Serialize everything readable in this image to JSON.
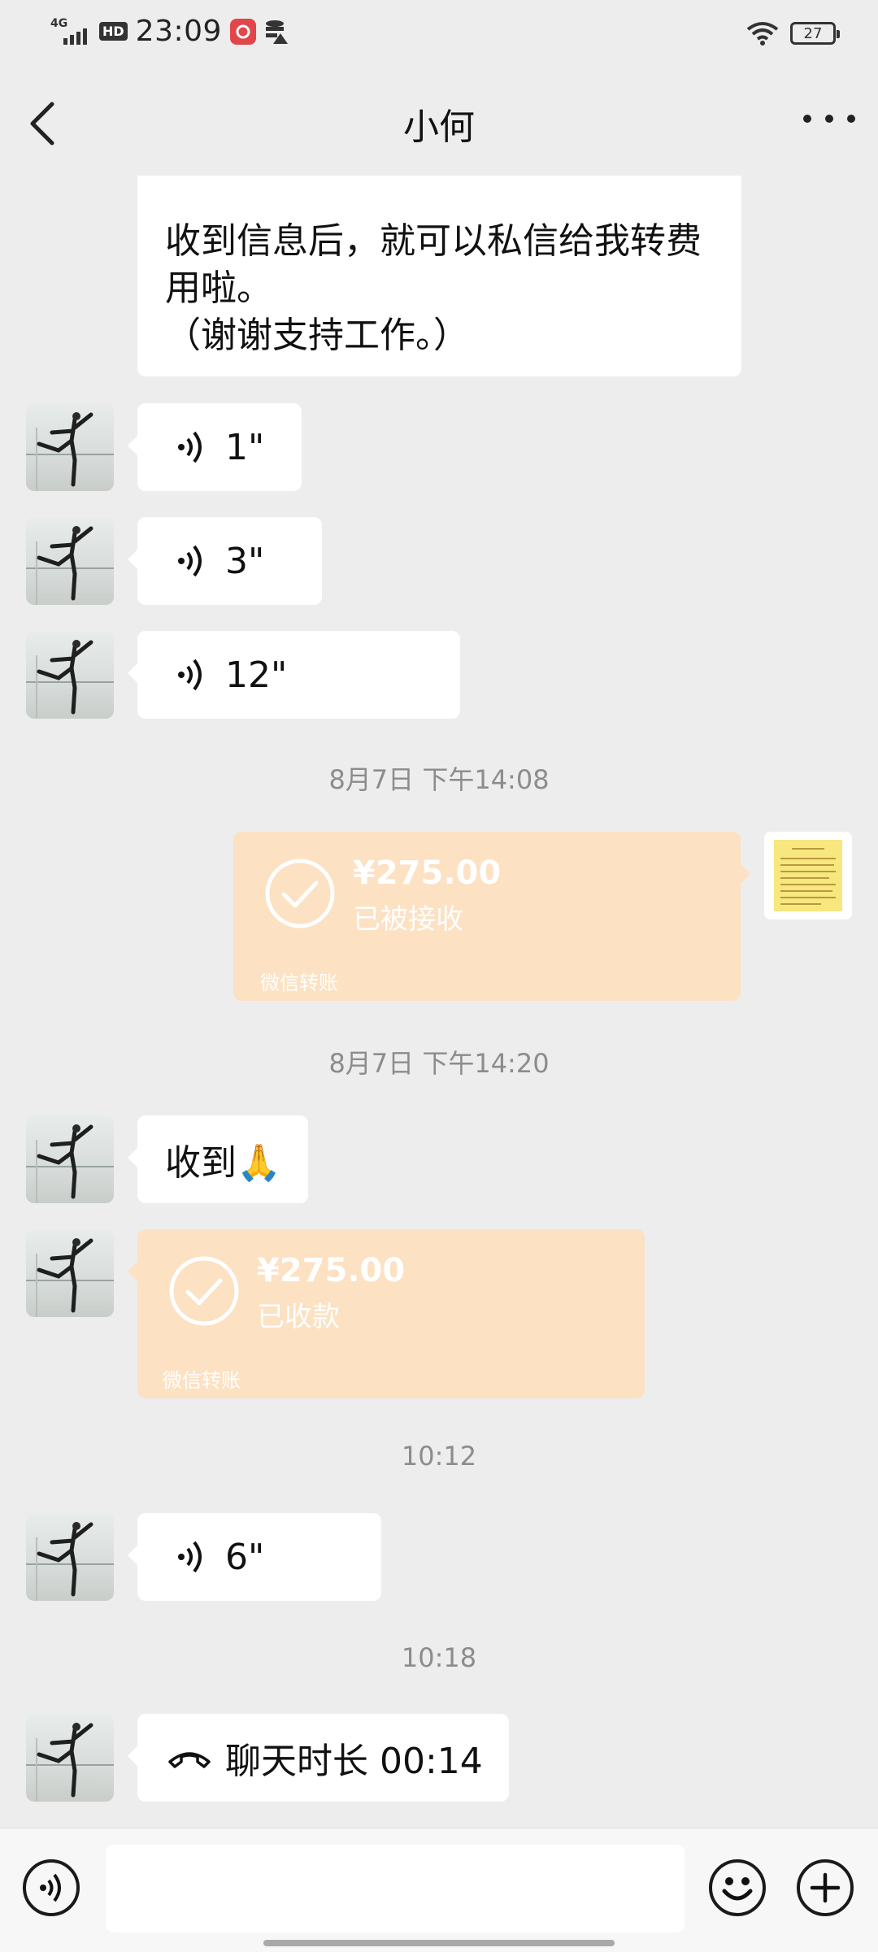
{
  "status_bar": {
    "network": "4G",
    "hd": "HD",
    "time": "23:09",
    "battery": "27"
  },
  "nav": {
    "title": "小何",
    "icons": {
      "back": "chevron-left-icon",
      "more": "more-dots-icon"
    }
  },
  "messages": {
    "m0": {
      "text_line1": "收到信息后，就可以私信给我转费",
      "text_line2": "用啦。",
      "text_line3": "（谢谢支持工作。）"
    },
    "m1": {
      "duration": "1\""
    },
    "m2": {
      "duration": "3\""
    },
    "m3": {
      "duration": "12\""
    },
    "ts1": "8月7日 下午14:08",
    "m4": {
      "amount": "¥275.00",
      "status": "已被接收",
      "source": "微信转账"
    },
    "ts2": "8月7日 下午14:20",
    "m5": {
      "text": "收到🙏"
    },
    "m6": {
      "amount": "¥275.00",
      "status": "已收款",
      "source": "微信转账"
    },
    "ts3": "10:12",
    "m7": {
      "duration": "6\""
    },
    "ts4": "10:18",
    "m8": {
      "text": "聊天时长 00:14"
    }
  },
  "input_bar": {
    "placeholder": "",
    "icons": {
      "voice": "voice-toggle-icon",
      "emoji": "emoji-icon",
      "plus": "plus-icon"
    }
  },
  "colors": {
    "background": "#ededed",
    "bubble": "#ffffff",
    "transfer": "#fce1c3",
    "timestamp": "#8c8c8c"
  }
}
